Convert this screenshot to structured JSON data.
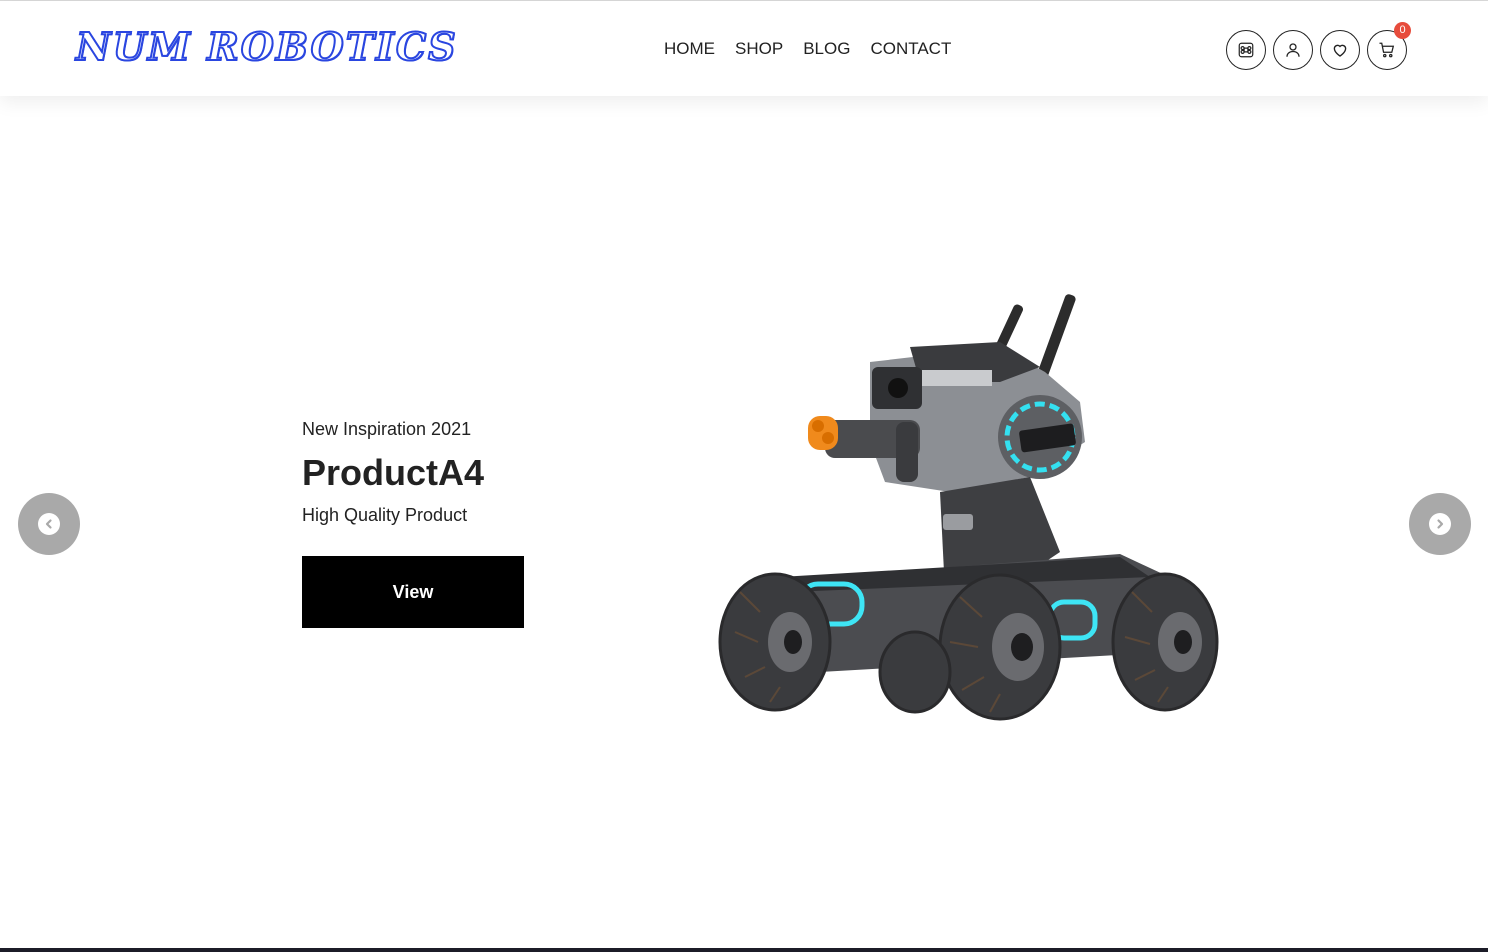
{
  "brand": {
    "logo_text": "NUM ROBOTICS",
    "color": "#2a46e0"
  },
  "nav": {
    "items": [
      {
        "label": "HOME"
      },
      {
        "label": "SHOP"
      },
      {
        "label": "BLOG"
      },
      {
        "label": "CONTACT"
      }
    ]
  },
  "header_icons": {
    "command": "command-icon",
    "account": "user-icon",
    "wishlist": "heart-icon",
    "cart": "cart-icon",
    "cart_count": "0",
    "badge_color": "#e74c3c"
  },
  "hero": {
    "eyebrow": "New Inspiration 2021",
    "title": "ProductA4",
    "subtitle": "High Quality Product",
    "button_label": "View",
    "image": "robot-tank-product-image"
  },
  "slider": {
    "prev": "chevron-left-icon",
    "next": "chevron-right-icon"
  }
}
